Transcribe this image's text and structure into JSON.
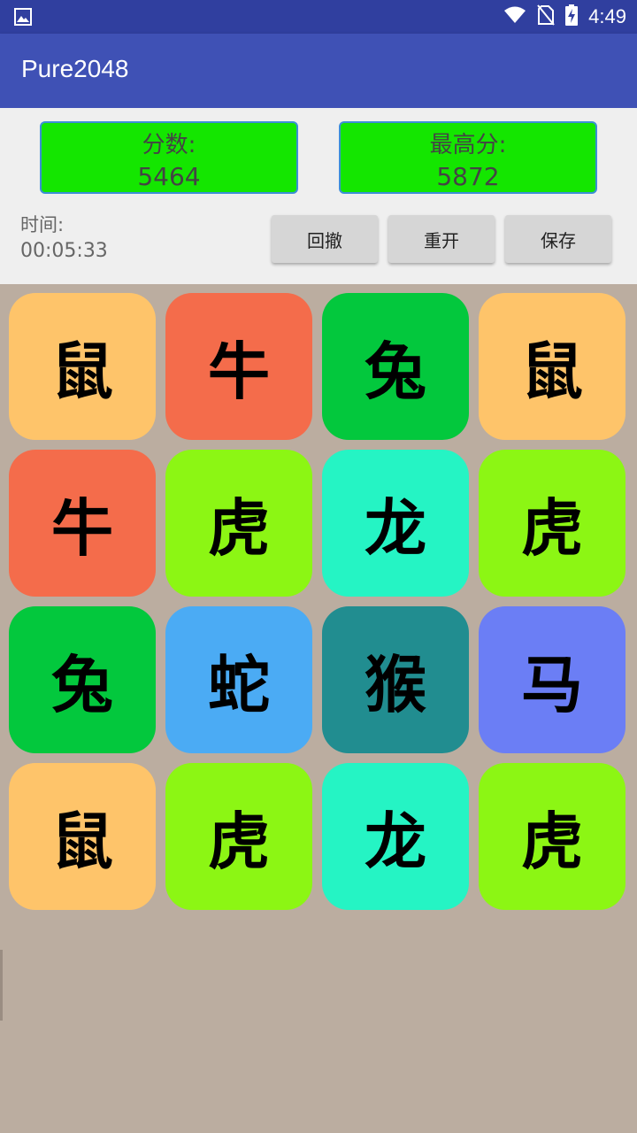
{
  "status_bar": {
    "time": "4:49",
    "icons": [
      "image-notification-icon",
      "wifi-icon",
      "no-sim-icon",
      "battery-charging-icon"
    ]
  },
  "app_bar": {
    "title": "Pure2048"
  },
  "scores": {
    "score_label": "分数:",
    "score_value": "5464",
    "best_label": "最高分:",
    "best_value": "5872"
  },
  "timer": {
    "label": "时间:",
    "value": "00:05:33"
  },
  "buttons": {
    "undo": "回撤",
    "restart": "重开",
    "save": "保存"
  },
  "colors": {
    "status_bar": "#303f9f",
    "app_bar": "#3f51b5",
    "score_box": "#14e600",
    "board_background": "#bbada0"
  },
  "board": {
    "rows": [
      [
        {
          "label": "鼠",
          "color": "#fec46a"
        },
        {
          "label": "牛",
          "color": "#f46c4b"
        },
        {
          "label": "兔",
          "color": "#03c83d"
        },
        {
          "label": "鼠",
          "color": "#fec46a"
        }
      ],
      [
        {
          "label": "牛",
          "color": "#f46c4b"
        },
        {
          "label": "虎",
          "color": "#8cf614"
        },
        {
          "label": "龙",
          "color": "#25f4c4"
        },
        {
          "label": "虎",
          "color": "#8cf614"
        }
      ],
      [
        {
          "label": "兔",
          "color": "#03c83d"
        },
        {
          "label": "蛇",
          "color": "#4babf4"
        },
        {
          "label": "猴",
          "color": "#218d90"
        },
        {
          "label": "马",
          "color": "#6b7ef5"
        }
      ],
      [
        {
          "label": "鼠",
          "color": "#fec46a"
        },
        {
          "label": "虎",
          "color": "#8cf614"
        },
        {
          "label": "龙",
          "color": "#25f4c4"
        },
        {
          "label": "虎",
          "color": "#8cf614"
        }
      ]
    ]
  }
}
